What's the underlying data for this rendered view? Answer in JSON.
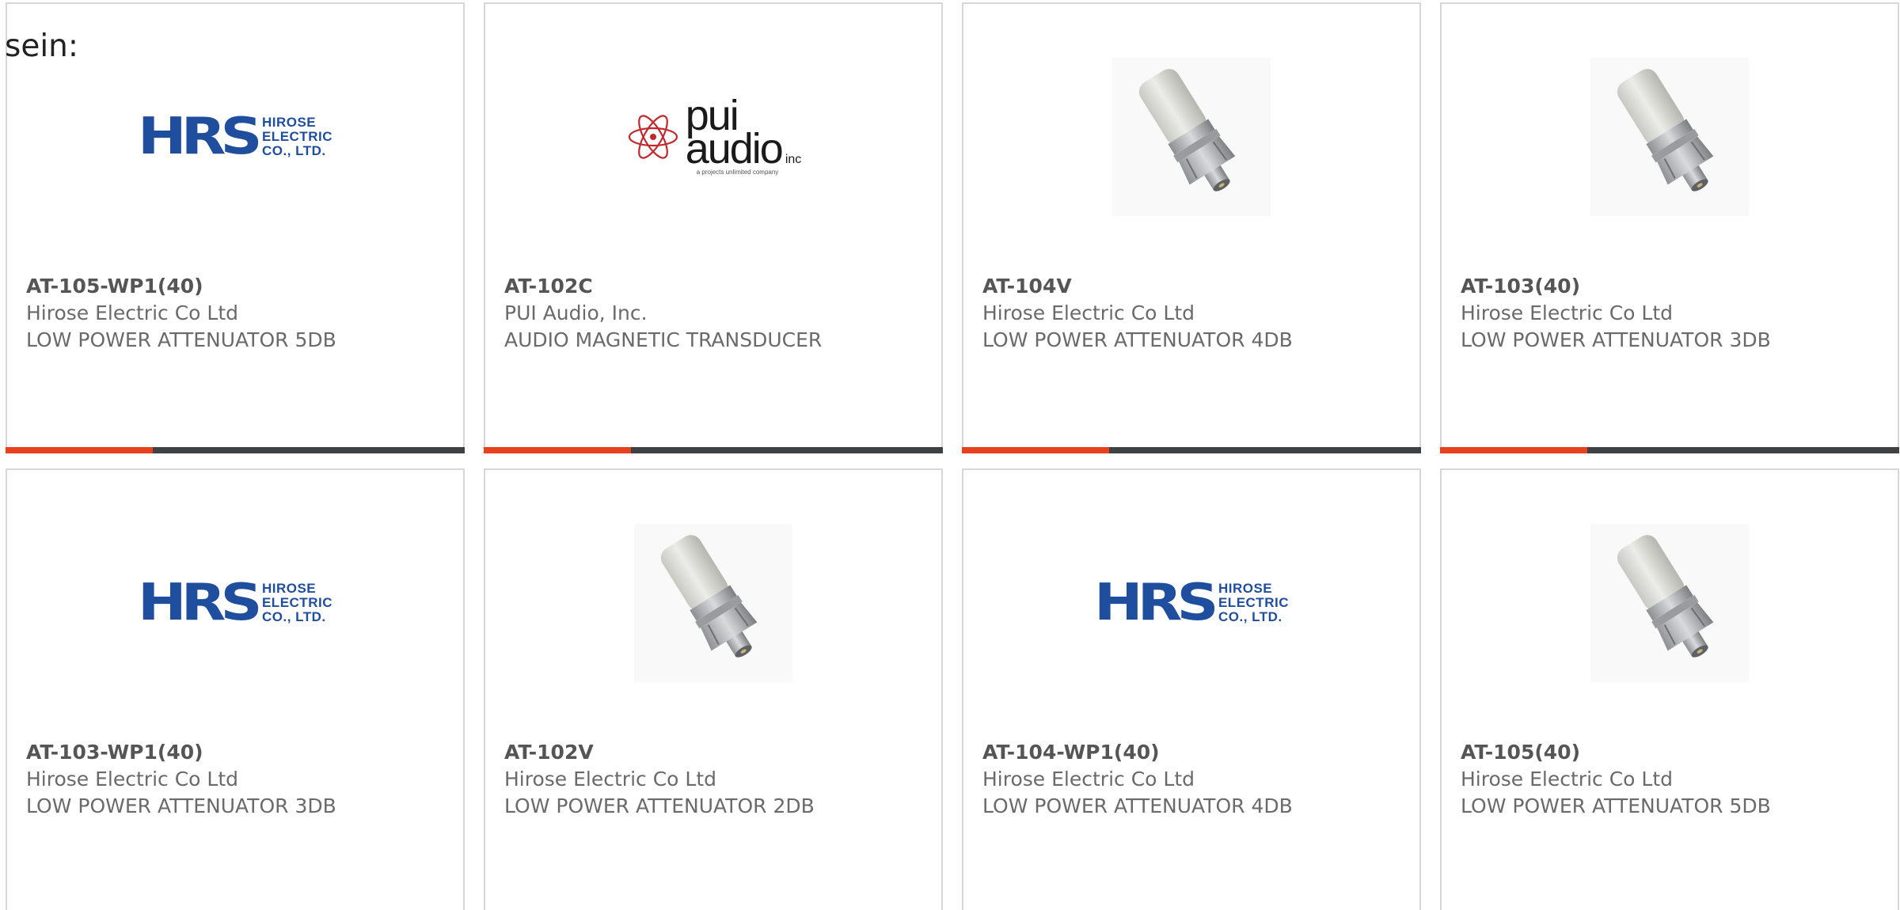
{
  "intro_text": "sein:",
  "colors": {
    "accent": "#e8411e",
    "track": "#3f4143",
    "border": "#d7d7d7",
    "hrs_blue": "#1f4e9e"
  },
  "hrs_logo": {
    "mark": "HRS",
    "line1": "HIROSE",
    "line2": "ELECTRIC",
    "line3": "CO., LTD."
  },
  "pui_logo": {
    "line1": "pui",
    "line2": "audio",
    "inc": "inc",
    "tagline": "a projects unlimited company"
  },
  "products": [
    {
      "part_number": "AT-105-WP1(40)",
      "manufacturer": "Hirose Electric Co Ltd",
      "description": "LOW POWER ATTENUATOR 5DB",
      "image": "hrs-logo",
      "progress": 0.32
    },
    {
      "part_number": "AT-102C",
      "manufacturer": "PUI Audio, Inc.",
      "description": "AUDIO MAGNETIC TRANSDUCER",
      "image": "pui-logo",
      "progress": 0.32
    },
    {
      "part_number": "AT-104V",
      "manufacturer": "Hirose Electric Co Ltd",
      "description": "LOW POWER ATTENUATOR 4DB",
      "image": "attenuator-photo",
      "progress": 0.32
    },
    {
      "part_number": "AT-103(40)",
      "manufacturer": "Hirose Electric Co Ltd",
      "description": "LOW POWER ATTENUATOR 3DB",
      "image": "attenuator-photo",
      "progress": 0.32
    },
    {
      "part_number": "AT-103-WP1(40)",
      "manufacturer": "Hirose Electric Co Ltd",
      "description": "LOW POWER ATTENUATOR 3DB",
      "image": "hrs-logo"
    },
    {
      "part_number": "AT-102V",
      "manufacturer": "Hirose Electric Co Ltd",
      "description": "LOW POWER ATTENUATOR 2DB",
      "image": "attenuator-photo"
    },
    {
      "part_number": "AT-104-WP1(40)",
      "manufacturer": "Hirose Electric Co Ltd",
      "description": "LOW POWER ATTENUATOR 4DB",
      "image": "hrs-logo"
    },
    {
      "part_number": "AT-105(40)",
      "manufacturer": "Hirose Electric Co Ltd",
      "description": "LOW POWER ATTENUATOR 5DB",
      "image": "attenuator-photo"
    }
  ]
}
